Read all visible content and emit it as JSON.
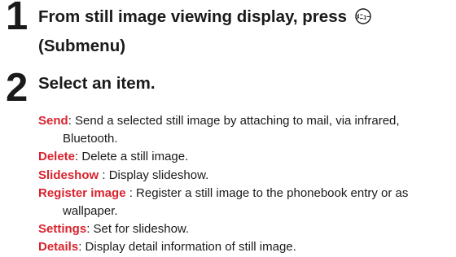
{
  "step1": {
    "number": "1",
    "line1": "From still image viewing display, press",
    "key_icon": "submenu-key-icon",
    "line2": "(Submenu)"
  },
  "step2": {
    "number": "2",
    "title": "Select an item."
  },
  "items": [
    {
      "term": "Send",
      "desc": ": Send a selected still image by attaching to mail, via infrared, Bluetooth."
    },
    {
      "term": "Delete",
      "desc": ": Delete a still image."
    },
    {
      "term": "Slideshow",
      "desc": " : Display slideshow."
    },
    {
      "term": "Register image",
      "desc": " : Register a still image to the phonebook entry or as wallpaper."
    },
    {
      "term": "Settings",
      "desc": ": Set for slideshow."
    },
    {
      "term": "Details",
      "desc": ": Display detail information of still image."
    }
  ],
  "colors": {
    "term": "#d9232e",
    "text": "#1a1a1a"
  }
}
